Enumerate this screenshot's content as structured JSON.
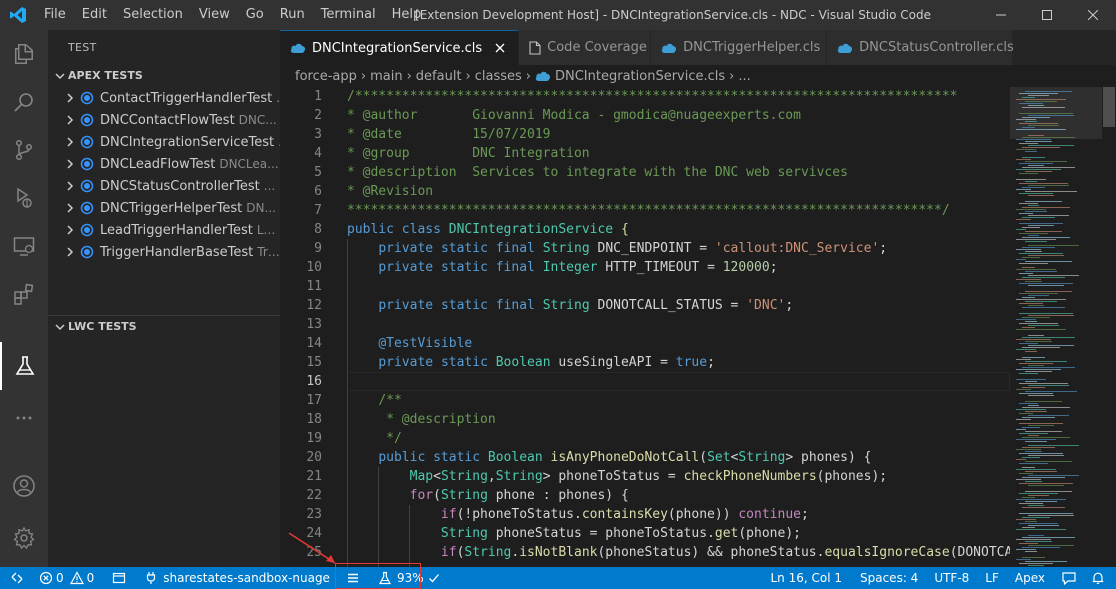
{
  "titlebar": {
    "menu": [
      "File",
      "Edit",
      "Selection",
      "View",
      "Go",
      "Run",
      "Terminal",
      "Help"
    ],
    "window_title": "[Extension Development Host] - DNCIntegrationService.cls - NDC - Visual Studio Code"
  },
  "activitybar": {
    "items": [
      "explorer-icon",
      "search-icon",
      "source-control-icon",
      "run-debug-icon",
      "remote-explorer-icon",
      "extensions-icon",
      "testing-icon",
      "more-icon",
      "account-icon",
      "settings-gear-icon"
    ],
    "active": "testing-icon"
  },
  "sidebar": {
    "title": "TEST",
    "apex_section": {
      "label": "APEX TESTS",
      "items": [
        {
          "label": "ContactTriggerHandlerTest",
          "desc": "..."
        },
        {
          "label": "DNCContactFlowTest",
          "desc": "DNC..."
        },
        {
          "label": "DNCIntegrationServiceTest",
          "desc": "..."
        },
        {
          "label": "DNCLeadFlowTest",
          "desc": "DNCLea..."
        },
        {
          "label": "DNCStatusControllerTest",
          "desc": "..."
        },
        {
          "label": "DNCTriggerHelperTest",
          "desc": "DN..."
        },
        {
          "label": "LeadTriggerHandlerTest",
          "desc": "Le..."
        },
        {
          "label": "TriggerHandlerBaseTest",
          "desc": "Tri..."
        }
      ]
    },
    "lwc_section": {
      "label": "LWC TESTS"
    }
  },
  "tabs": [
    {
      "label": "DNCIntegrationService.cls",
      "icon": "apex-file-icon",
      "active": true
    },
    {
      "label": "Code Coverage",
      "icon": "document-icon",
      "active": false
    },
    {
      "label": "DNCTriggerHelper.cls",
      "icon": "apex-file-icon",
      "active": false
    },
    {
      "label": "DNCStatusController.cls",
      "icon": "apex-file-icon",
      "active": false
    }
  ],
  "breadcrumb": [
    "force-app",
    "main",
    "default",
    "classes",
    "DNCIntegrationService.cls",
    "..."
  ],
  "editor": {
    "line_numbers": [
      "1",
      "2",
      "3",
      "4",
      "5",
      "6",
      "7",
      "8",
      "9",
      "10",
      "11",
      "12",
      "13",
      "14",
      "15",
      "16",
      "17",
      "18",
      "19",
      "20",
      "21",
      "22",
      "23",
      "24",
      "25"
    ],
    "lines": [
      [
        [
          "c-com",
          "/*****************************************************************************"
        ]
      ],
      [
        [
          "c-com",
          "* @author       Giovanni Modica - gmodica@nuageexperts.com"
        ]
      ],
      [
        [
          "c-com",
          "* @date         15/07/2019"
        ]
      ],
      [
        [
          "c-com",
          "* @group        DNC Integration"
        ]
      ],
      [
        [
          "c-com",
          "* @description  Services to integrate with the DNC web servivces"
        ]
      ],
      [
        [
          "c-com",
          "* @Revision"
        ]
      ],
      [
        [
          "c-com",
          "****************************************************************************/"
        ]
      ],
      [
        [
          "c-kw",
          "public"
        ],
        [
          "c-def",
          " "
        ],
        [
          "c-kw",
          "class"
        ],
        [
          "c-def",
          " "
        ],
        [
          "c-ty",
          "DNCIntegrationService"
        ],
        [
          "c-def",
          " "
        ],
        [
          "c-fn",
          "{"
        ]
      ],
      [
        [
          "c-def",
          "    "
        ],
        [
          "c-kw",
          "private"
        ],
        [
          "c-def",
          " "
        ],
        [
          "c-kw",
          "static"
        ],
        [
          "c-def",
          " "
        ],
        [
          "c-kw",
          "final"
        ],
        [
          "c-def",
          " "
        ],
        [
          "c-ty",
          "String"
        ],
        [
          "c-def",
          " DNC_ENDPOINT = "
        ],
        [
          "c-str",
          "'callout:DNC_Service'"
        ],
        [
          "c-def",
          ";"
        ]
      ],
      [
        [
          "c-def",
          "    "
        ],
        [
          "c-kw",
          "private"
        ],
        [
          "c-def",
          " "
        ],
        [
          "c-kw",
          "static"
        ],
        [
          "c-def",
          " "
        ],
        [
          "c-kw",
          "final"
        ],
        [
          "c-def",
          " "
        ],
        [
          "c-ty",
          "Integer"
        ],
        [
          "c-def",
          " HTTP_TIMEOUT = "
        ],
        [
          "c-num",
          "120000"
        ],
        [
          "c-def",
          ";"
        ]
      ],
      [
        [
          "c-def",
          ""
        ]
      ],
      [
        [
          "c-def",
          "    "
        ],
        [
          "c-kw",
          "private"
        ],
        [
          "c-def",
          " "
        ],
        [
          "c-kw",
          "static"
        ],
        [
          "c-def",
          " "
        ],
        [
          "c-kw",
          "final"
        ],
        [
          "c-def",
          " "
        ],
        [
          "c-ty",
          "String"
        ],
        [
          "c-def",
          " DONOTCALL_STATUS = "
        ],
        [
          "c-str",
          "'DNC'"
        ],
        [
          "c-def",
          ";"
        ]
      ],
      [
        [
          "c-def",
          ""
        ]
      ],
      [
        [
          "c-def",
          "    "
        ],
        [
          "c-kw",
          "@TestVisible"
        ]
      ],
      [
        [
          "c-def",
          "    "
        ],
        [
          "c-kw",
          "private"
        ],
        [
          "c-def",
          " "
        ],
        [
          "c-kw",
          "static"
        ],
        [
          "c-def",
          " "
        ],
        [
          "c-ty",
          "Boolean"
        ],
        [
          "c-def",
          " useSingleAPI = "
        ],
        [
          "c-kw",
          "true"
        ],
        [
          "c-def",
          ";"
        ]
      ],
      [
        [
          "c-def",
          ""
        ]
      ],
      [
        [
          "c-def",
          "    "
        ],
        [
          "c-com",
          "/**"
        ]
      ],
      [
        [
          "c-def",
          "    "
        ],
        [
          "c-com",
          " * @description"
        ]
      ],
      [
        [
          "c-def",
          "    "
        ],
        [
          "c-com",
          " */"
        ]
      ],
      [
        [
          "c-def",
          "    "
        ],
        [
          "c-kw",
          "public"
        ],
        [
          "c-def",
          " "
        ],
        [
          "c-kw",
          "static"
        ],
        [
          "c-def",
          " "
        ],
        [
          "c-ty",
          "Boolean"
        ],
        [
          "c-def",
          " "
        ],
        [
          "c-fn",
          "isAnyPhoneDoNotCall"
        ],
        [
          "c-def",
          "("
        ],
        [
          "c-ty",
          "Set"
        ],
        [
          "c-def",
          "<"
        ],
        [
          "c-ty",
          "String"
        ],
        [
          "c-def",
          "> phones) {"
        ]
      ],
      [
        [
          "c-def",
          "        "
        ],
        [
          "c-ty",
          "Map"
        ],
        [
          "c-def",
          "<"
        ],
        [
          "c-ty",
          "String"
        ],
        [
          "c-def",
          ","
        ],
        [
          "c-ty",
          "String"
        ],
        [
          "c-def",
          "> phoneToStatus = "
        ],
        [
          "c-fn",
          "checkPhoneNumbers"
        ],
        [
          "c-def",
          "(phones);"
        ]
      ],
      [
        [
          "c-def",
          "        "
        ],
        [
          "c-ctl",
          "for"
        ],
        [
          "c-def",
          "("
        ],
        [
          "c-ty",
          "String"
        ],
        [
          "c-def",
          " phone : phones) {"
        ]
      ],
      [
        [
          "c-def",
          "            "
        ],
        [
          "c-ctl",
          "if"
        ],
        [
          "c-def",
          "(!phoneToStatus."
        ],
        [
          "c-fn",
          "containsKey"
        ],
        [
          "c-def",
          "(phone)) "
        ],
        [
          "c-ctl",
          "continue"
        ],
        [
          "c-def",
          ";"
        ]
      ],
      [
        [
          "c-def",
          "            "
        ],
        [
          "c-ty",
          "String"
        ],
        [
          "c-def",
          " phoneStatus = phoneToStatus."
        ],
        [
          "c-fn",
          "get"
        ],
        [
          "c-def",
          "(phone);"
        ]
      ],
      [
        [
          "c-def",
          "            "
        ],
        [
          "c-ctl",
          "if"
        ],
        [
          "c-def",
          "("
        ],
        [
          "c-ty",
          "String"
        ],
        [
          "c-def",
          "."
        ],
        [
          "c-fn",
          "isNotBlank"
        ],
        [
          "c-def",
          "(phoneStatus) && phoneStatus."
        ],
        [
          "c-fn",
          "equalsIgnoreCase"
        ],
        [
          "c-def",
          "(DONOTCALL"
        ]
      ]
    ]
  },
  "statusbar": {
    "remote": "remote-icon",
    "errors": "0",
    "warnings": "0",
    "org": "sharestates-sandbox-nuage",
    "coverage": "93%",
    "cursor": "Ln 16, Col 1",
    "spaces": "Spaces: 4",
    "encoding": "UTF-8",
    "eol": "LF",
    "language": "Apex"
  },
  "colors": {
    "accent": "#007acc",
    "highlight_annotation": "#e53935"
  }
}
